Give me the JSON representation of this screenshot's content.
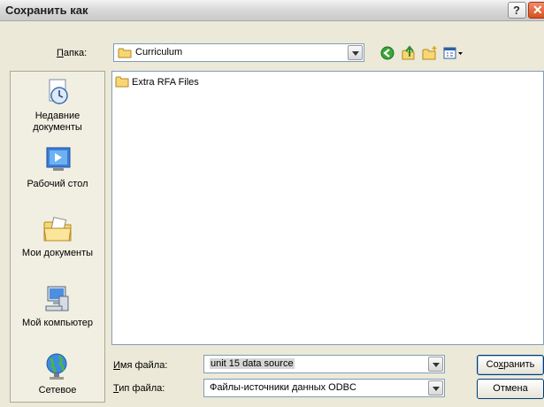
{
  "window": {
    "title": "Сохранить как",
    "help_label": "?",
    "close_label": "✕"
  },
  "lookin": {
    "label_first": "П",
    "label_rest": "апка:",
    "value": "Curriculum"
  },
  "toolbar": {
    "back_icon": "back-icon",
    "up_icon": "up-folder-icon",
    "new_folder_icon": "new-folder-icon",
    "views_icon": "views-menu-icon"
  },
  "places": [
    {
      "label": "Недавние документы",
      "icon": "recent-documents-icon"
    },
    {
      "label": "Рабочий стол",
      "icon": "desktop-icon"
    },
    {
      "label": "Мои документы",
      "icon": "my-documents-icon"
    },
    {
      "label": "Мой компьютер",
      "icon": "my-computer-icon"
    },
    {
      "label": "Сетевое",
      "icon": "network-icon"
    }
  ],
  "files": [
    {
      "name": "Extra RFA Files",
      "type": "folder"
    }
  ],
  "filename": {
    "label_first": "И",
    "label_rest": "мя файла:",
    "value": "unit 15 data source"
  },
  "filetype": {
    "label_first": "Т",
    "label_rest": "ип файла:",
    "value": "Файлы-источники данных ODBC"
  },
  "buttons": {
    "save_pre": "Со",
    "save_ul": "х",
    "save_post": "ранить",
    "cancel": "Отмена"
  }
}
